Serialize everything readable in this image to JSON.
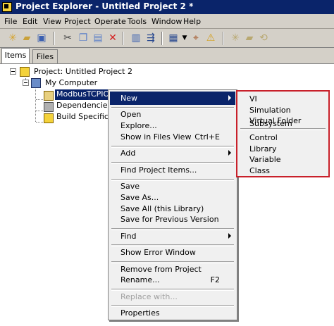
{
  "window": {
    "title": "Project Explorer - Untitled Project 2 *"
  },
  "menubar": [
    "File",
    "Edit",
    "View",
    "Project",
    "Operate",
    "Tools",
    "Window",
    "Help"
  ],
  "toolbar": {
    "icons": [
      "new-icon",
      "open-icon",
      "save-all-icon",
      "cut-icon",
      "copy-icon",
      "paste-icon",
      "delete-icon",
      "build-icon",
      "deploy-icon",
      "view-options-icon",
      "find-icon",
      "warning-icon",
      "add-file-icon",
      "add-folder-icon",
      "sync-icon"
    ]
  },
  "tabs": [
    "Items",
    "Files"
  ],
  "tree": {
    "project": "Project: Untitled Project 2",
    "computer": "My Computer",
    "library": "ModbusTCPIOSe",
    "dependencies": "Dependencies",
    "build": "Build Specification"
  },
  "context_menu": {
    "new": "New",
    "open": "Open",
    "explore": "Explore...",
    "show_in_files": "Show in Files View",
    "show_in_files_shortcut": "Ctrl+E",
    "add": "Add",
    "find_items": "Find Project Items...",
    "save": "Save",
    "save_as": "Save As...",
    "save_all": "Save All (this Library)",
    "save_prev": "Save for Previous Version",
    "find": "Find",
    "show_error": "Show Error Window",
    "remove": "Remove from Project",
    "rename": "Rename...",
    "rename_shortcut": "F2",
    "replace": "Replace with...",
    "properties": "Properties"
  },
  "submenu": {
    "vi": "VI",
    "sim": "Simulation Subsystem",
    "vfolder": "Virtual Folder",
    "control": "Control",
    "library": "Library",
    "variable": "Variable",
    "class": "Class"
  },
  "colors": {
    "titlebar": "#0a246a",
    "selection": "#0a246a",
    "submenu_border": "#c8202a",
    "chrome": "#d4d0c8"
  }
}
